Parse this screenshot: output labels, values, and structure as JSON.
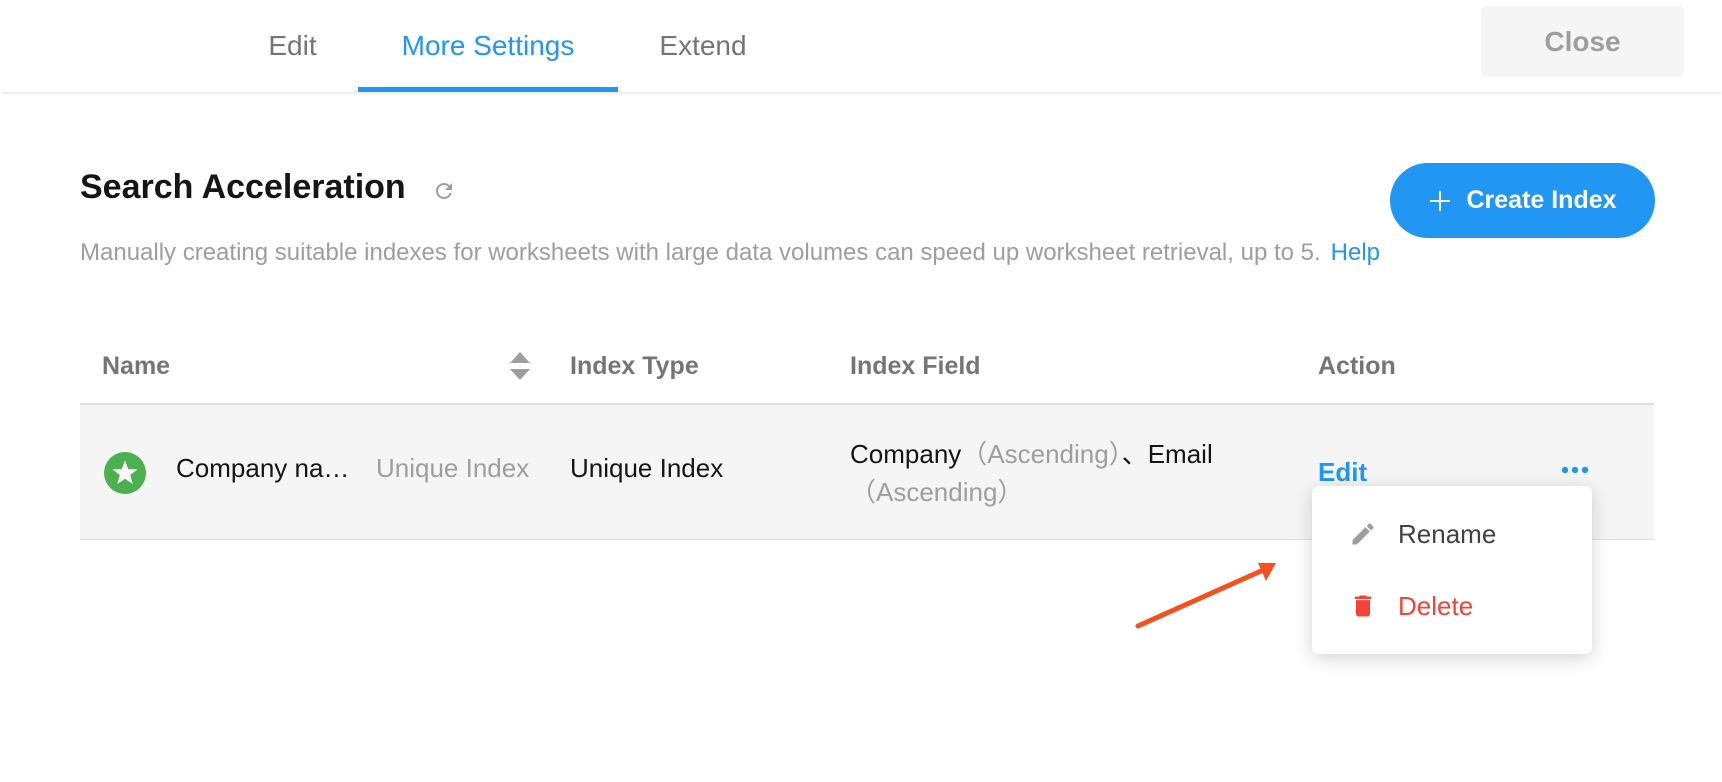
{
  "tabs": [
    {
      "label": "Edit",
      "active": false
    },
    {
      "label": "More Settings",
      "active": true
    },
    {
      "label": "Extend",
      "active": false
    }
  ],
  "close_label": "Close",
  "section": {
    "title": "Search Acceleration",
    "description": "Manually creating suitable indexes for worksheets with large data volumes can speed up worksheet retrieval, up to 5.",
    "help_label": "Help",
    "create_button_label": "Create Index"
  },
  "table": {
    "columns": [
      "Name",
      "Index Type",
      "Index Field",
      "Action"
    ],
    "rows": [
      {
        "name": "Company na…",
        "name_tag": "Unique Index",
        "index_type": "Unique Index",
        "index_field": {
          "field1": "Company",
          "order1": "（Ascending）",
          "separator": "、",
          "field2": "Email",
          "order2": "（Ascending）"
        },
        "action_label": "Edit"
      }
    ]
  },
  "menu": {
    "items": [
      {
        "label": "Rename",
        "icon": "pencil-icon",
        "color": "#424242"
      },
      {
        "label": "Delete",
        "icon": "trash-icon",
        "color": "#f44336"
      }
    ]
  },
  "colors": {
    "accent": "#2196f3",
    "danger": "#f44336",
    "success": "#4caf50",
    "annotation": "#f4511e"
  }
}
